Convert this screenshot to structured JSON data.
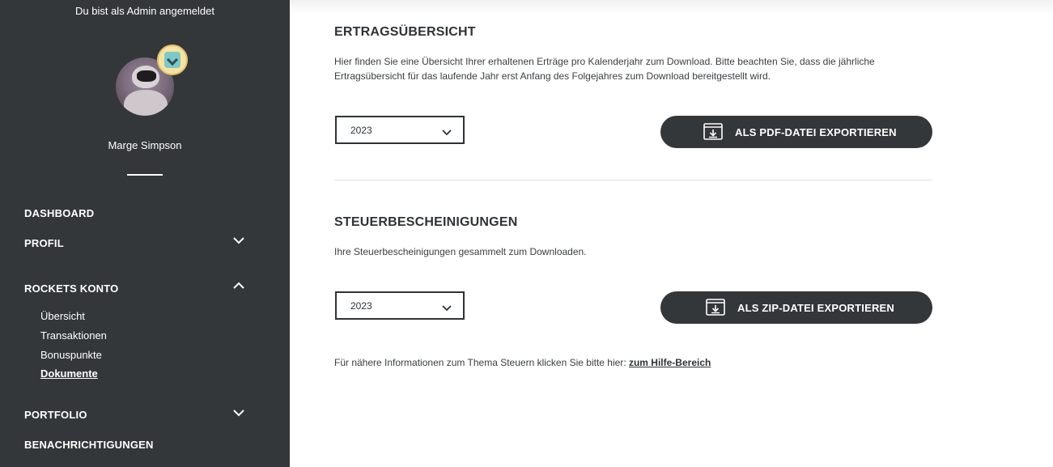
{
  "sidebar": {
    "admin_note": "Du bist als Admin angemeldet",
    "username": "Marge Simpson",
    "nav": {
      "dashboard": "DASHBOARD",
      "profil": "PROFIL",
      "rockets_konto": "ROCKETS KONTO",
      "portfolio": "PORTFOLIO",
      "benachrichtigungen": "BENACHRICHTIGUNGEN"
    },
    "sub_items": [
      "Übersicht",
      "Transaktionen",
      "Bonuspunkte",
      "Dokumente"
    ],
    "active_sub_item": "Dokumente"
  },
  "ertrag": {
    "title": "ERTRAGSÜBERSICHT",
    "text_line1": "Hier finden Sie eine Übersicht Ihrer erhaltenen Erträge pro Kalenderjahr zum Download. Bitte beachten Sie, dass die jährliche",
    "text_line2": "Ertragsübersicht für das laufende Jahr erst Anfang des Folgejahres zum Download bereitgestellt wird.",
    "year": "2023",
    "button": "ALS PDF-DATEI EXPORTIEREN"
  },
  "steuer": {
    "title": "STEUERBESCHEINIGUNGEN",
    "text": "Ihre Steuerbescheinigungen gesammelt zum Downloaden.",
    "year": "2023",
    "button": "ALS ZIP-DATEI EXPORTIEREN"
  },
  "help": {
    "text": "Für nähere Informationen zum Thema Steuern klicken Sie bitte hier: ",
    "link": "zum Hilfe-Bereich"
  },
  "colors": {
    "sidebar_bg": "#33373a",
    "button_bg": "#33373a",
    "text": "#2f3336"
  },
  "icons": [
    "chevron-down-icon",
    "chevron-up-icon",
    "download-icon",
    "rank-badge-icon"
  ]
}
